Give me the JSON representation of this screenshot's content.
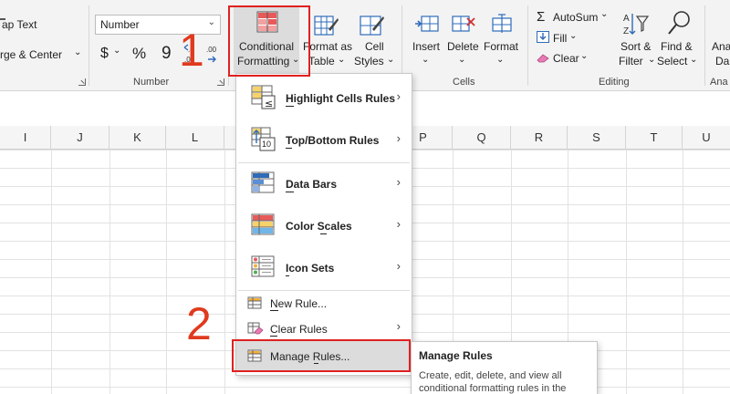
{
  "ribbon": {
    "alignment": {
      "wrap_text": "ap Text",
      "merge_center": "rge & Center"
    },
    "number": {
      "format_value": "Number",
      "currency_symbol": "$",
      "percent_symbol": "%",
      "comma_symbol": "9",
      "group_label": "Number"
    },
    "styles": {
      "conditional_formatting": [
        "Conditional",
        "Formatting"
      ],
      "format_as_table": [
        "Format as",
        "Table"
      ],
      "cell_styles": [
        "Cell",
        "Styles"
      ]
    },
    "cells": {
      "insert": "Insert",
      "delete": "Delete",
      "format": "Format",
      "group_label": "Cells"
    },
    "editing": {
      "autosum": "AutoSum",
      "fill": "Fill",
      "clear": "Clear",
      "sort_filter": [
        "Sort &",
        "Filter"
      ],
      "find_select": [
        "Find &",
        "Select"
      ],
      "group_label": "Editing"
    },
    "next_group_partial": [
      "Ana",
      "Da",
      "Ana"
    ]
  },
  "columns": [
    "I",
    "J",
    "K",
    "L",
    "P",
    "Q",
    "R",
    "S",
    "T",
    "U"
  ],
  "menu": {
    "items": [
      {
        "label": "Highlight Cells Rules",
        "mnemonic": "H",
        "has_submenu": true,
        "icon": "highlight-cells-icon"
      },
      {
        "label": "Top/Bottom Rules",
        "mnemonic": "T",
        "has_submenu": true,
        "icon": "top-bottom-icon"
      },
      {
        "label": "Data Bars",
        "mnemonic": "D",
        "has_submenu": true,
        "icon": "data-bars-icon"
      },
      {
        "label": "Color Scales",
        "mnemonic": "S",
        "has_submenu": true,
        "icon": "color-scales-icon"
      },
      {
        "label": "Icon Sets",
        "mnemonic": "I",
        "has_submenu": true,
        "icon": "icon-sets-icon"
      },
      {
        "label": "New Rule...",
        "mnemonic": "N",
        "has_submenu": false,
        "icon": "new-rule-icon"
      },
      {
        "label": "Clear Rules",
        "mnemonic": "C",
        "has_submenu": true,
        "icon": "clear-rules-icon"
      },
      {
        "label": "Manage Rules...",
        "mnemonic": "R",
        "has_submenu": false,
        "icon": "manage-rules-icon"
      }
    ],
    "icon_top_bottom_number": "10"
  },
  "tooltip": {
    "title": "Manage Rules",
    "body_line1": "Create, edit, delete, and view all",
    "body_line2": "conditional formatting rules in the"
  },
  "annotations": {
    "step1": "1",
    "step2": "2"
  },
  "colors": {
    "annotation_red": "#e02020",
    "annotation_number": "#e03a1e",
    "ribbon_bg": "#f3f3f3",
    "hover_bg": "#dcdcdc",
    "icon_blue": "#2e6bb8"
  }
}
